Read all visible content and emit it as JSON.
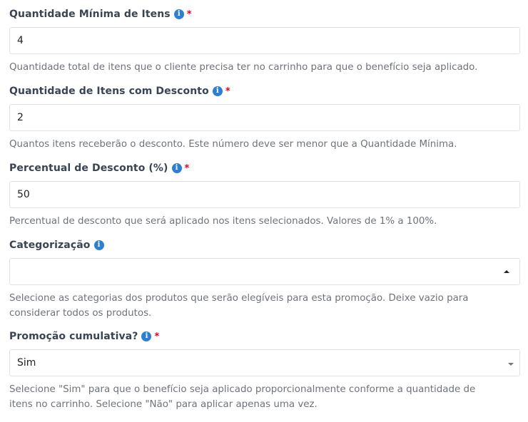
{
  "fields": [
    {
      "label": "Quantidade Mínima de Itens",
      "required": "*",
      "info_icon": "info-icon",
      "value": "4",
      "help": "Quantidade total de itens que o cliente precisa ter no carrinho para que o benefício seja aplicado."
    },
    {
      "label": "Quantidade de Itens com Desconto",
      "required": "*",
      "info_icon": "info-icon",
      "value": "2",
      "help": "Quantos itens receberão o desconto. Este número deve ser menor que a Quantidade Mínima."
    },
    {
      "label": "Percentual de Desconto (%)",
      "required": "*",
      "info_icon": "info-icon",
      "value": "50",
      "help": "Percentual de desconto que será aplicado nos itens selecionados. Valores de 1% a 100%."
    },
    {
      "label": "Categorização",
      "info_icon": "info-icon",
      "value": "",
      "help_line1": "Selecione as categorias dos produtos que serão elegíveis para esta promoção. Deixe vazio para",
      "help_line2": "considerar todos os produtos."
    },
    {
      "label": "Promoção cumulativa?",
      "required": "*",
      "info_icon": "info-icon",
      "value": "Sim",
      "help_line1": "Selecione \"Sim\" para que o benefício seja aplicado proporcionalmente conforme a quantidade de",
      "help_line2": "itens no carrinho. Selecione \"Não\" para aplicar apenas uma vez."
    }
  ],
  "colors": {
    "info_icon": "#2f7fd1",
    "required": "#e0001b",
    "label": "#3b4452",
    "help": "#6e737a"
  }
}
